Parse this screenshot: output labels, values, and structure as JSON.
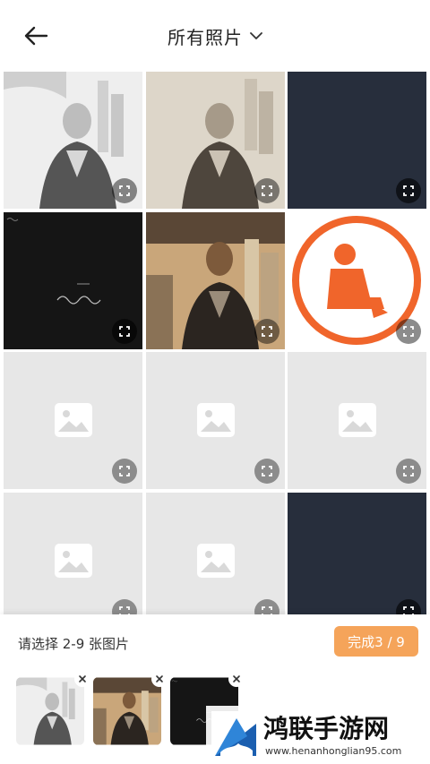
{
  "header": {
    "title": "所有照片",
    "back_icon": "arrow-left-icon",
    "dropdown_icon": "chevron-down-icon"
  },
  "grid": [
    {
      "kind": "sketch",
      "label": "photo-sketch-portrait-1"
    },
    {
      "kind": "warm",
      "label": "photo-warm-portrait"
    },
    {
      "kind": "dark",
      "label": "photo-dark-blank-1"
    },
    {
      "kind": "black",
      "label": "photo-black-handwriting"
    },
    {
      "kind": "sunset",
      "label": "photo-sunset-portrait"
    },
    {
      "kind": "warn",
      "label": "photo-construction-icon"
    },
    {
      "kind": "placeholder",
      "label": "photo-placeholder-1"
    },
    {
      "kind": "placeholder",
      "label": "photo-placeholder-2"
    },
    {
      "kind": "placeholder",
      "label": "photo-placeholder-3"
    },
    {
      "kind": "placeholder",
      "label": "photo-placeholder-4"
    },
    {
      "kind": "placeholder",
      "label": "photo-placeholder-5"
    },
    {
      "kind": "dark",
      "label": "photo-dark-blank-2"
    }
  ],
  "bottom": {
    "hint": "请选择 2-9 张图片",
    "done_label": "完成3 / 9",
    "selected": [
      {
        "kind": "sketch"
      },
      {
        "kind": "sunset"
      },
      {
        "kind": "black"
      }
    ]
  },
  "watermark": {
    "text": "鸿联手游网",
    "url": "www.henanhonglian95.com"
  },
  "colors": {
    "accent": "#f5a45a",
    "dark_tile": "#272e3c",
    "placeholder": "#e7e7e7",
    "warning_orange": "#f0652b"
  }
}
